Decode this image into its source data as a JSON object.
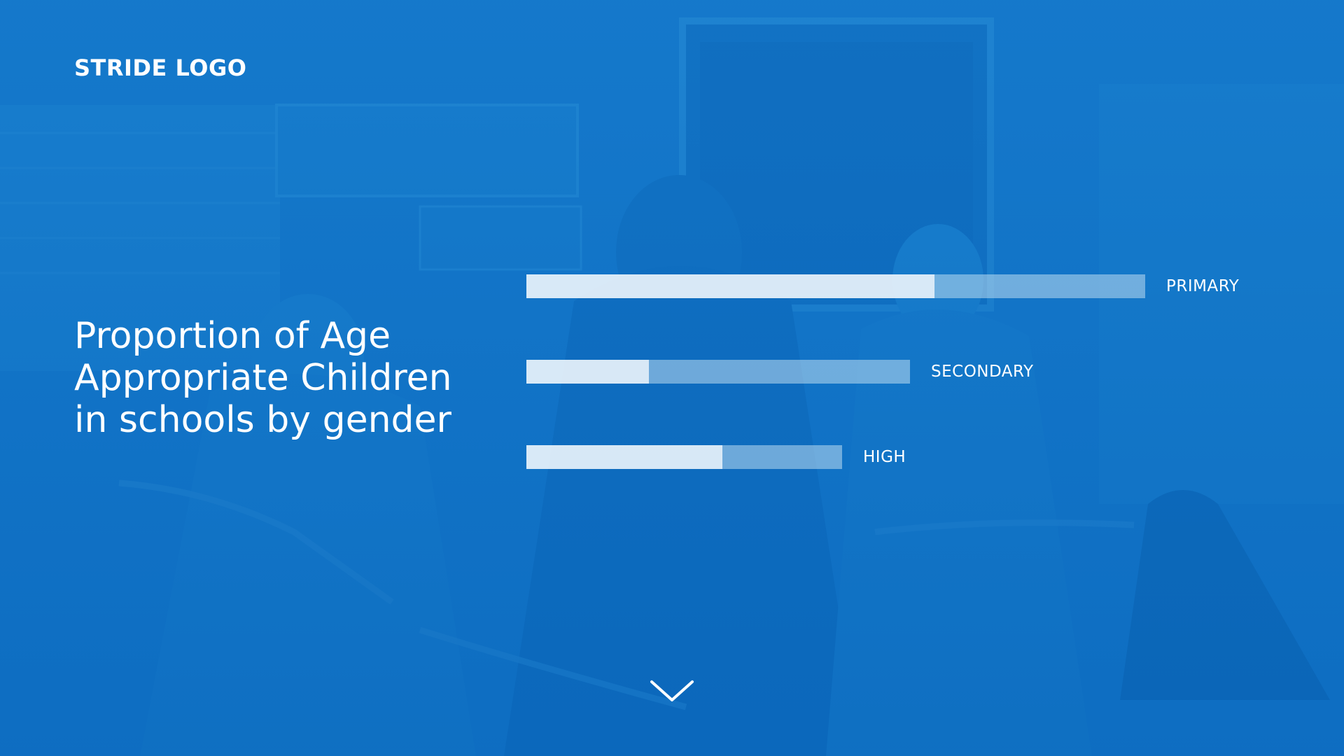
{
  "logo": {
    "text": "STRIDE LOGO"
  },
  "heading": {
    "lines": [
      "Proportion of Age",
      "Appropriate Children",
      "in schools by gender"
    ]
  },
  "colors": {
    "background": "#1474c8",
    "bar_fill": "#e1eef8",
    "bar_track": "#8fc0e6",
    "text": "#ffffff"
  },
  "icons": {
    "scroll": "chevron-down-icon"
  },
  "chart_data": {
    "type": "bar",
    "orientation": "horizontal",
    "categories": [
      "PRIMARY",
      "SECONDARY",
      "HIGH"
    ],
    "series": [
      {
        "values": [
          0.66,
          0.32,
          0.62
        ]
      }
    ],
    "totals": [
      1.0,
      0.62,
      0.51
    ]
  }
}
